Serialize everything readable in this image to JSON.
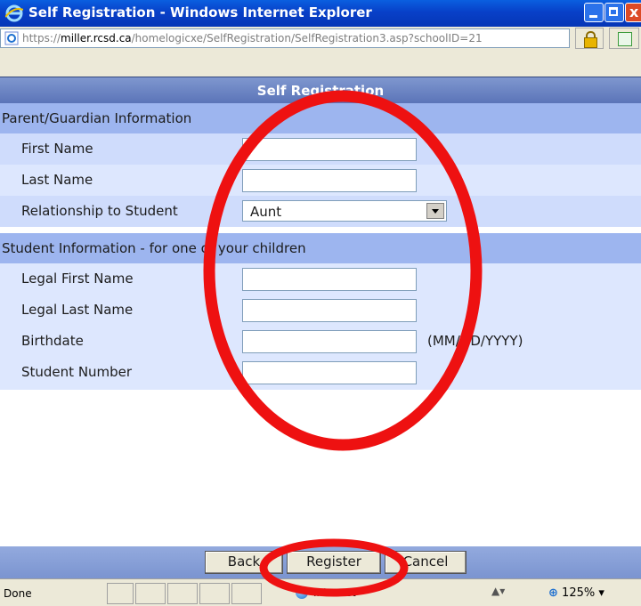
{
  "window": {
    "title": "Self Registration - Windows Internet Explorer",
    "close_glyph": "x"
  },
  "address": {
    "url_scheme": "https://",
    "url_host": "miller.rcsd.ca",
    "url_path": "/homelogicxe/SelfRegistration/SelfRegistration3.asp?schoolID=21"
  },
  "page": {
    "header": "Self Registration",
    "parent_section": {
      "title": "Parent/Guardian Information",
      "first_name_label": "First Name",
      "last_name_label": "Last Name",
      "relationship_label": "Relationship to Student",
      "relationship_value": "Aunt"
    },
    "student_section": {
      "title": "Student Information - for one of your children",
      "legal_first_label": "Legal First Name",
      "legal_last_label": "Legal Last Name",
      "birthdate_label": "Birthdate",
      "birthdate_hint": "(MM/DD/YYYY)",
      "student_number_label": "Student Number"
    },
    "buttons": {
      "back": "Back",
      "register": "Register",
      "cancel": "Cancel"
    }
  },
  "status": {
    "text": "Done",
    "zone": "Internet",
    "zoom": "125%"
  },
  "colors": {
    "annotation": "#ee1111",
    "section_header": "#9db5ef",
    "row_a": "#cfdcfc",
    "row_b": "#dde7fe"
  }
}
